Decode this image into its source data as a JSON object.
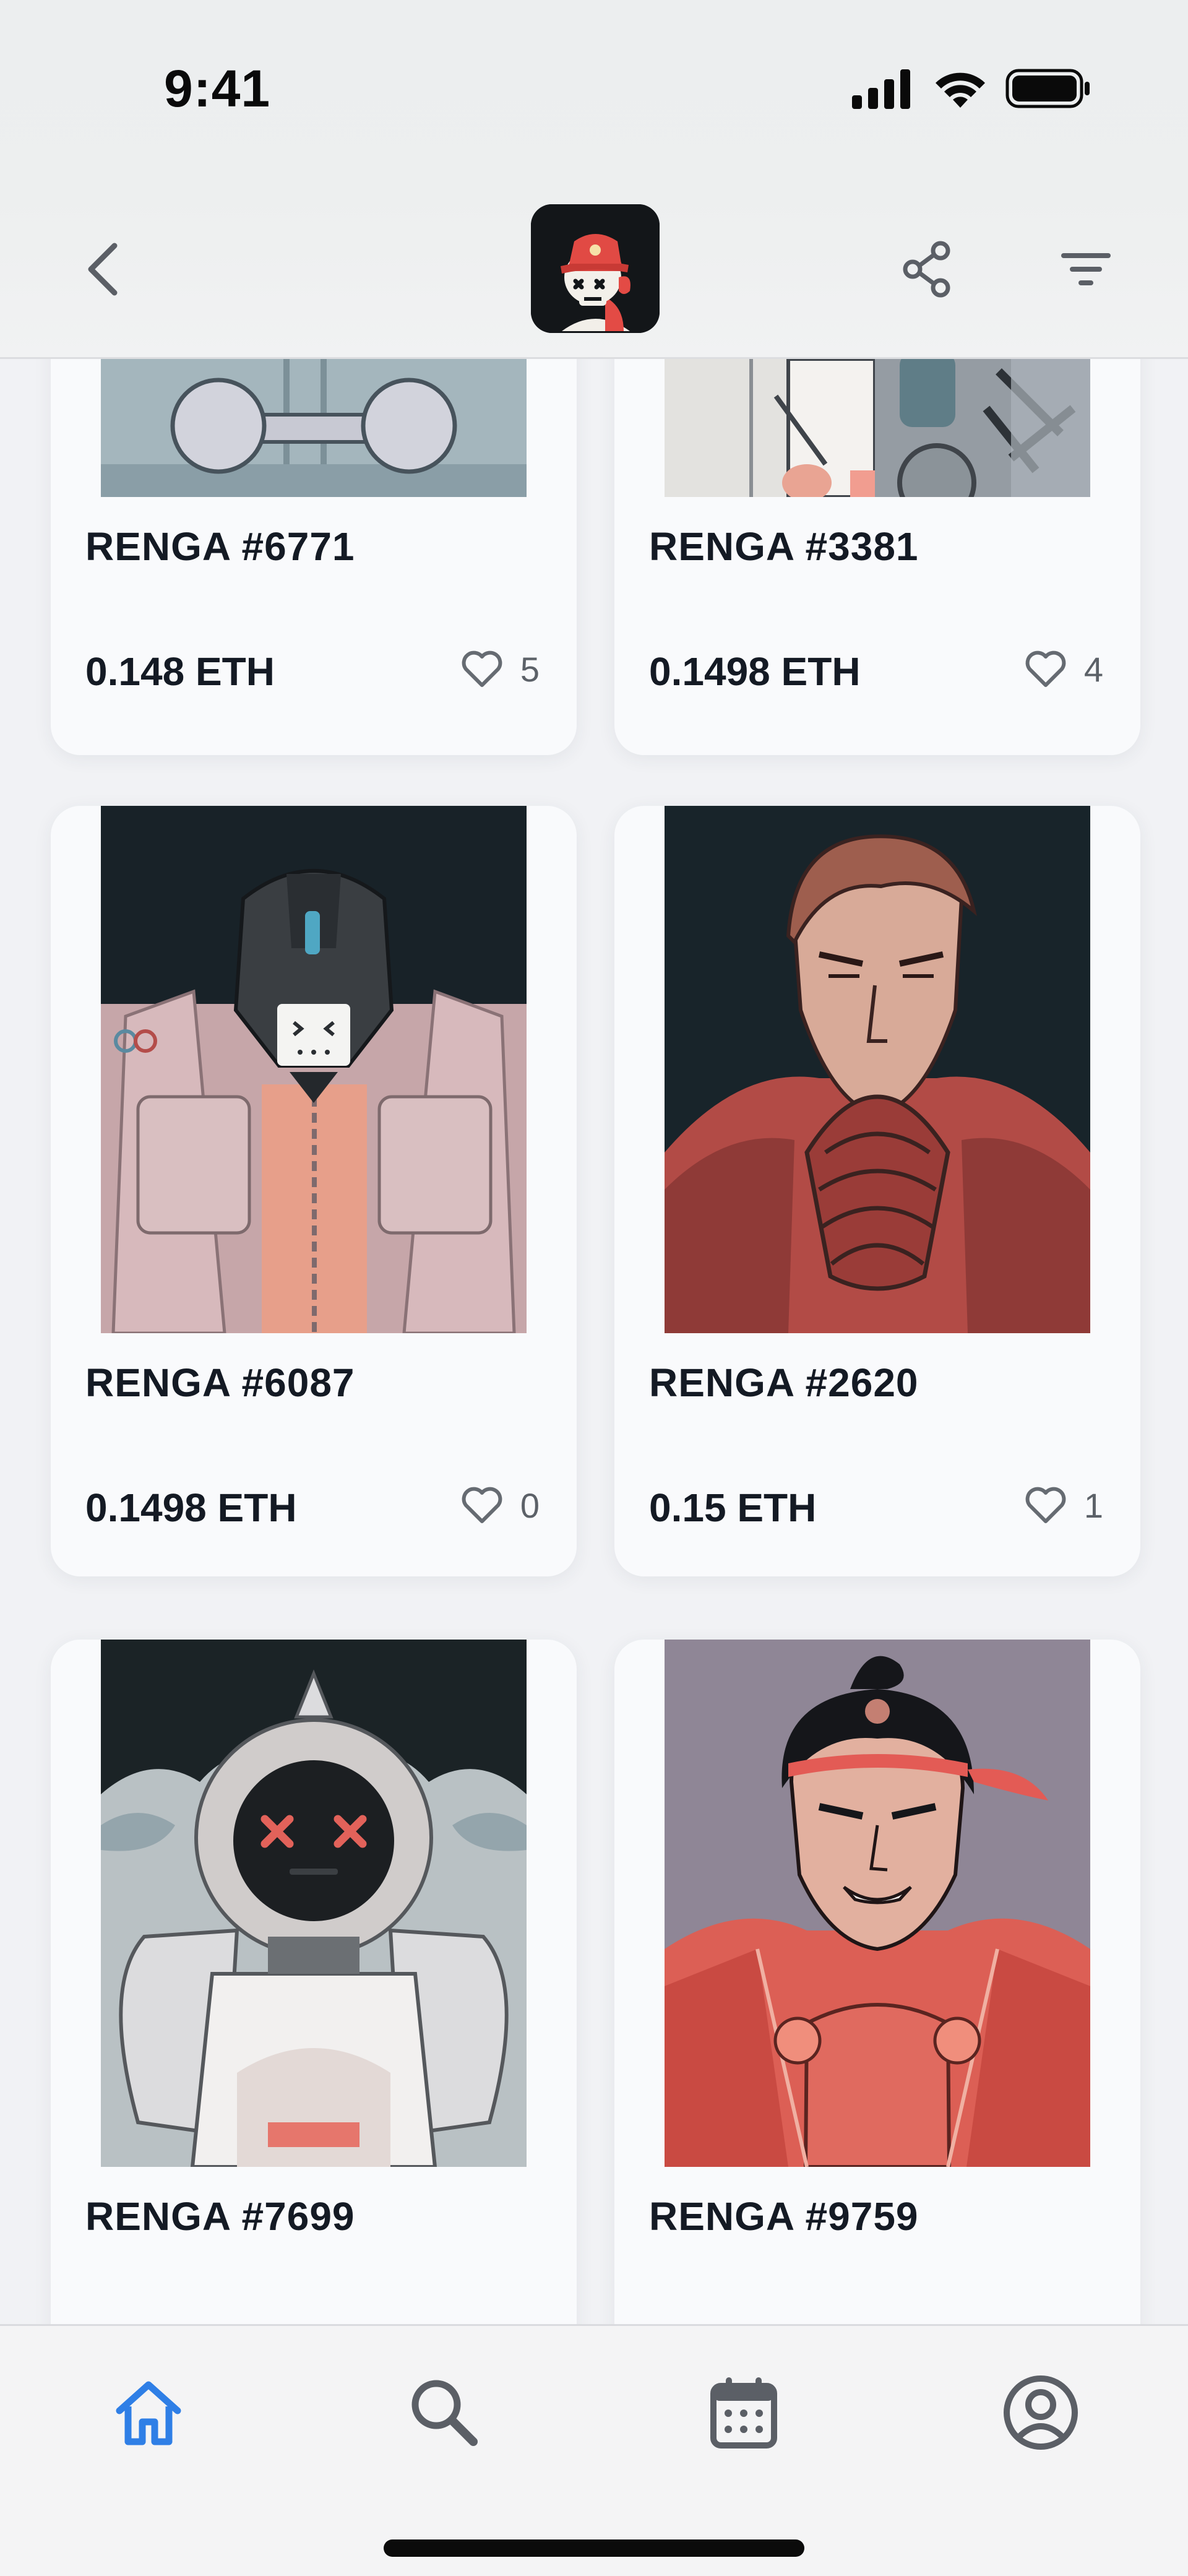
{
  "status_bar": {
    "time": "9:41"
  },
  "nav": {
    "back_icon": "chevron-left-icon",
    "share_icon": "share-icon",
    "filter_icon": "filter-icon",
    "logo": "collection-avatar-skull"
  },
  "items": [
    {
      "title": "RENGA #6771",
      "price": "0.148 ETH",
      "likes": "5"
    },
    {
      "title": "RENGA #3381",
      "price": "0.1498 ETH",
      "likes": "4"
    },
    {
      "title": "RENGA #6087",
      "price": "0.1498 ETH",
      "likes": "0"
    },
    {
      "title": "RENGA #2620",
      "price": "0.15 ETH",
      "likes": "1"
    },
    {
      "title": "RENGA #7699"
    },
    {
      "title": "RENGA #9759"
    }
  ],
  "tabbar": {
    "tabs": [
      {
        "name": "home",
        "icon": "home-icon",
        "active": true
      },
      {
        "name": "search",
        "icon": "search-icon",
        "active": false
      },
      {
        "name": "calendar",
        "icon": "calendar-icon",
        "active": false
      },
      {
        "name": "profile",
        "icon": "profile-icon",
        "active": false
      }
    ]
  },
  "colors": {
    "accent": "#2f7fe6",
    "text": "#141a24",
    "muted": "#5c6168",
    "card": "#f9fafc"
  }
}
